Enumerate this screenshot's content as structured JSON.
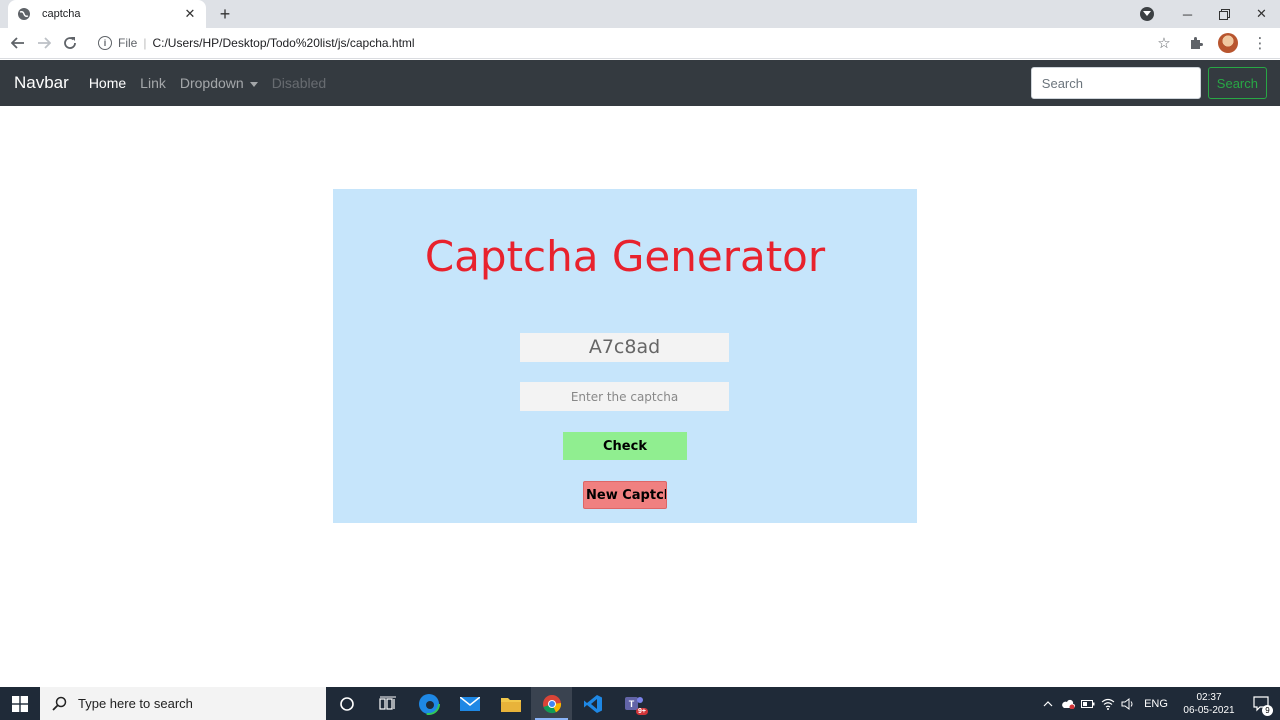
{
  "browser": {
    "tab_title": "captcha",
    "url_scheme": "File",
    "url_path": "C:/Users/HP/Desktop/Todo%20list/js/capcha.html"
  },
  "navbar": {
    "brand": "Navbar",
    "links": [
      "Home",
      "Link",
      "Dropdown",
      "Disabled"
    ],
    "search_placeholder": "Search",
    "search_button": "Search"
  },
  "captcha": {
    "title": "Captcha Generator",
    "code": "A7c8ad",
    "input_placeholder": "Enter the captcha",
    "check_label": "Check",
    "new_label": "New Captcha"
  },
  "taskbar": {
    "search_placeholder": "Type here to search",
    "teams_badge": "9+",
    "language": "ENG",
    "time": "02:37",
    "date": "06-05-2021",
    "notification_count": "9"
  },
  "colors": {
    "navbar_bg": "#343a40",
    "card_bg": "#c6e5fb",
    "title_red": "#e8222d",
    "check_green": "#90ee90",
    "new_red": "#f08080"
  }
}
